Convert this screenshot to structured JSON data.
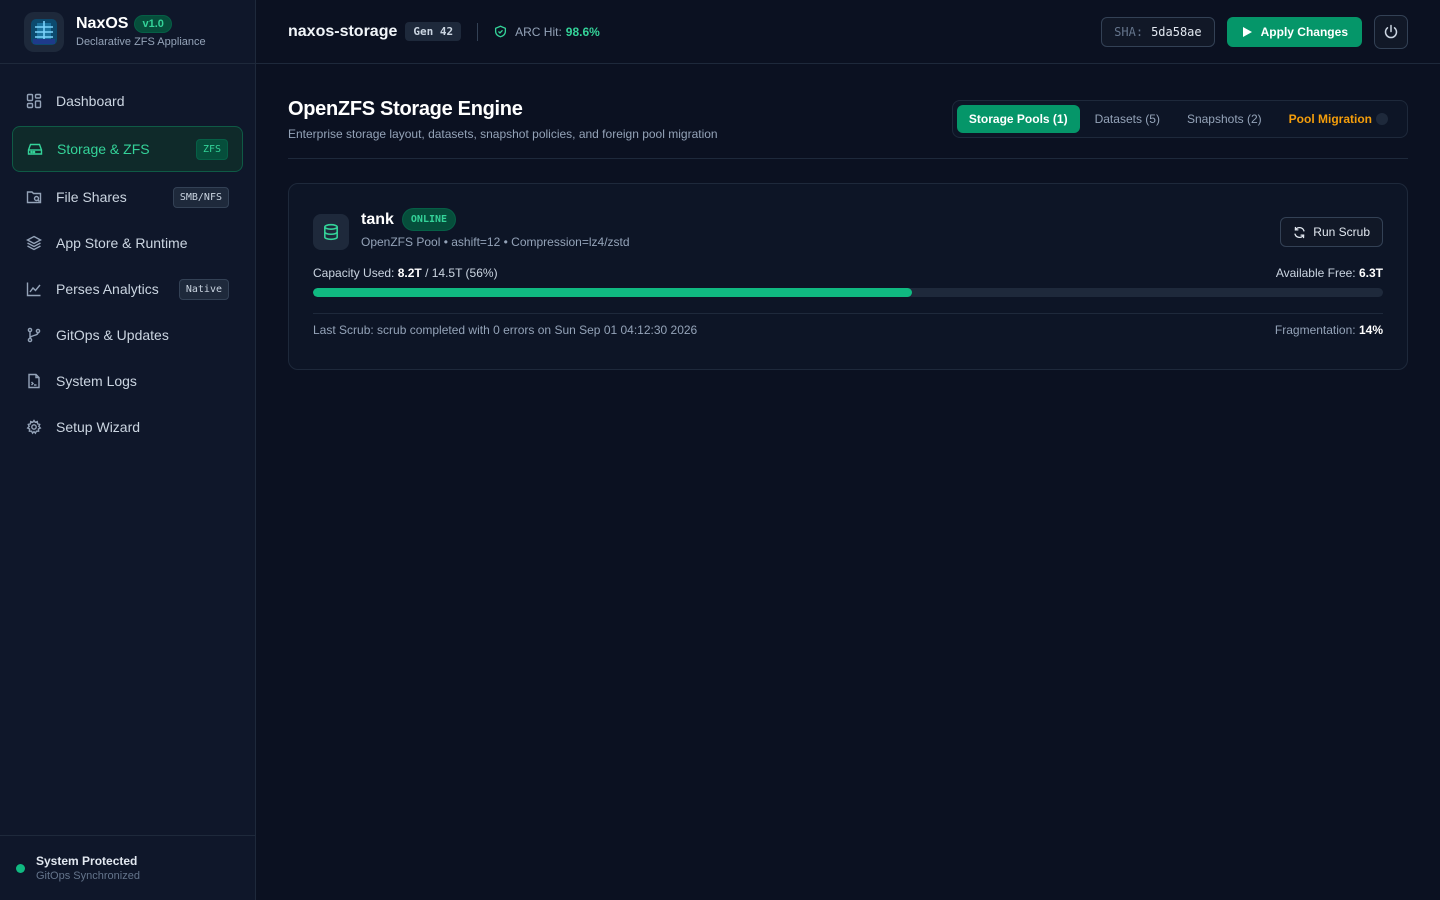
{
  "brand": {
    "name": "NaxOS",
    "version": "v1.0",
    "subtitle": "Declarative ZFS Appliance"
  },
  "sidebar": {
    "items": [
      {
        "label": "Dashboard",
        "icon": "dashboard-icon",
        "badge": ""
      },
      {
        "label": "Storage & ZFS",
        "icon": "hard-drive-icon",
        "badge": "ZFS",
        "active": true
      },
      {
        "label": "File Shares",
        "icon": "folder-share-icon",
        "badge": "SMB/NFS"
      },
      {
        "label": "App Store & Runtime",
        "icon": "layers-icon",
        "badge": ""
      },
      {
        "label": "Perses Analytics",
        "icon": "line-chart-icon",
        "badge": "Native"
      },
      {
        "label": "GitOps & Updates",
        "icon": "git-branch-icon",
        "badge": ""
      },
      {
        "label": "System Logs",
        "icon": "file-log-icon",
        "badge": ""
      },
      {
        "label": "Setup Wizard",
        "icon": "gear-icon",
        "badge": ""
      }
    ],
    "footer": {
      "title": "System Protected",
      "subtitle": "GitOps Synchronized"
    }
  },
  "header": {
    "hostname": "naxos-storage",
    "generation": "Gen 42",
    "arc_label": "ARC Hit:",
    "arc_value": "98.6%",
    "sha_label": "SHA:",
    "sha_value": "5da58ae",
    "apply_label": "Apply Changes"
  },
  "page": {
    "title": "OpenZFS Storage Engine",
    "subtitle": "Enterprise storage layout, datasets, snapshot policies, and foreign pool migration",
    "tabs": [
      {
        "label": "Storage Pools (1)"
      },
      {
        "label": "Datasets (5)"
      },
      {
        "label": "Snapshots (2)"
      },
      {
        "label": "Pool Migration"
      }
    ]
  },
  "pool": {
    "name": "tank",
    "status": "ONLINE",
    "meta": "OpenZFS Pool • ashift=12 • Compression=lz4/zstd",
    "scrub_button": "Run Scrub",
    "capacity_label": "Capacity Used:",
    "capacity_used": "8.2T",
    "capacity_total": "/ 14.5T (56%)",
    "capacity_fraction": 0.56,
    "free_label": "Available Free:",
    "free_value": "6.3T",
    "last_scrub": "Last Scrub: scrub completed with 0 errors on Sun Sep 01 04:12:30 2026",
    "frag_label": "Fragmentation:",
    "frag_value": "14%"
  },
  "colors": {
    "accent": "#10b981",
    "accent_dark": "#059669",
    "warning": "#f59e0b",
    "background": "#0b1121",
    "sidebar": "#0f172a"
  }
}
